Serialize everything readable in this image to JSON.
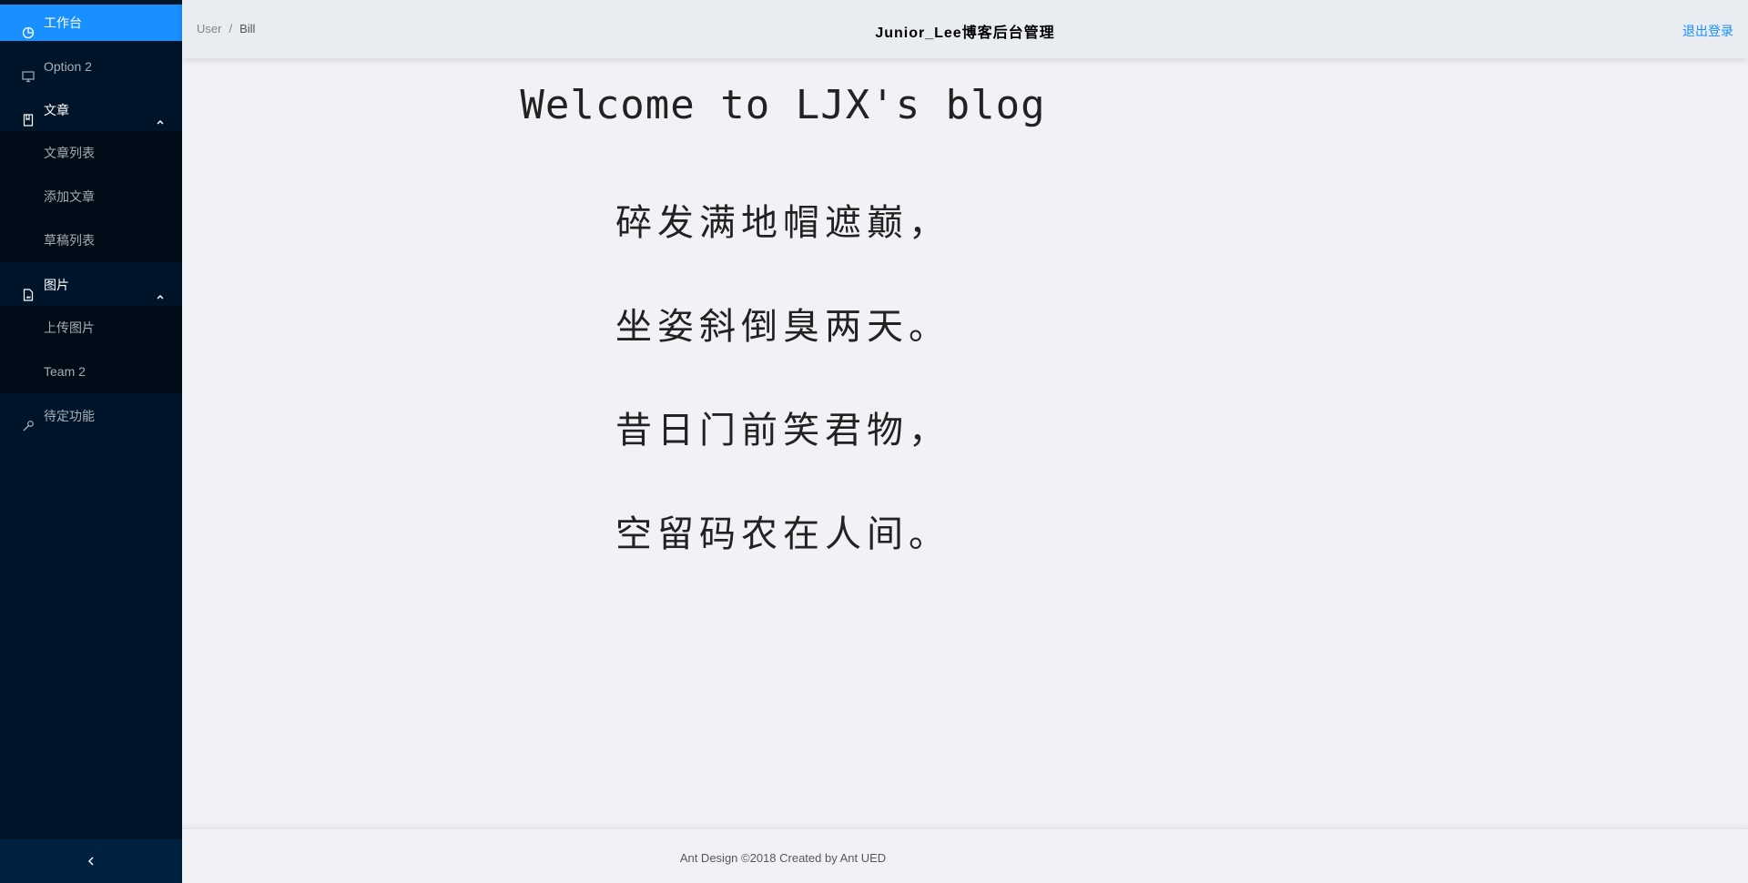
{
  "colors": {
    "sider_bg": "#001529",
    "submenu_bg": "#000c17",
    "selected_bg": "#1890ff",
    "accent": "#1890ff",
    "content_bg": "#f0f2f5"
  },
  "sidebar": {
    "items": [
      {
        "label": "工作台",
        "icon": "dashboard-icon",
        "selected": true
      },
      {
        "label": "Option 2",
        "icon": "desktop-icon"
      },
      {
        "label": "文章",
        "icon": "book-icon",
        "open": true,
        "children": [
          {
            "label": "文章列表"
          },
          {
            "label": "添加文章"
          },
          {
            "label": "草稿列表"
          }
        ]
      },
      {
        "label": "图片",
        "icon": "file-image-icon",
        "open": true,
        "children": [
          {
            "label": "上传图片"
          },
          {
            "label": "Team 2"
          }
        ]
      },
      {
        "label": "待定功能",
        "icon": "tool-icon"
      }
    ],
    "collapse_icon": "chevron-left-icon"
  },
  "header": {
    "breadcrumb": [
      "User",
      "Bill"
    ],
    "breadcrumb_separator": "/",
    "title": "Junior_Lee博客后台管理",
    "logout_label": "退出登录"
  },
  "main": {
    "welcome": "Welcome to LJX's blog",
    "poem": [
      "碎发满地帽遮巅，",
      "坐姿斜倒臭两天。",
      "昔日门前笑君物，",
      "空留码农在人间。"
    ]
  },
  "footer": {
    "text": "Ant Design ©2018 Created by Ant UED"
  }
}
